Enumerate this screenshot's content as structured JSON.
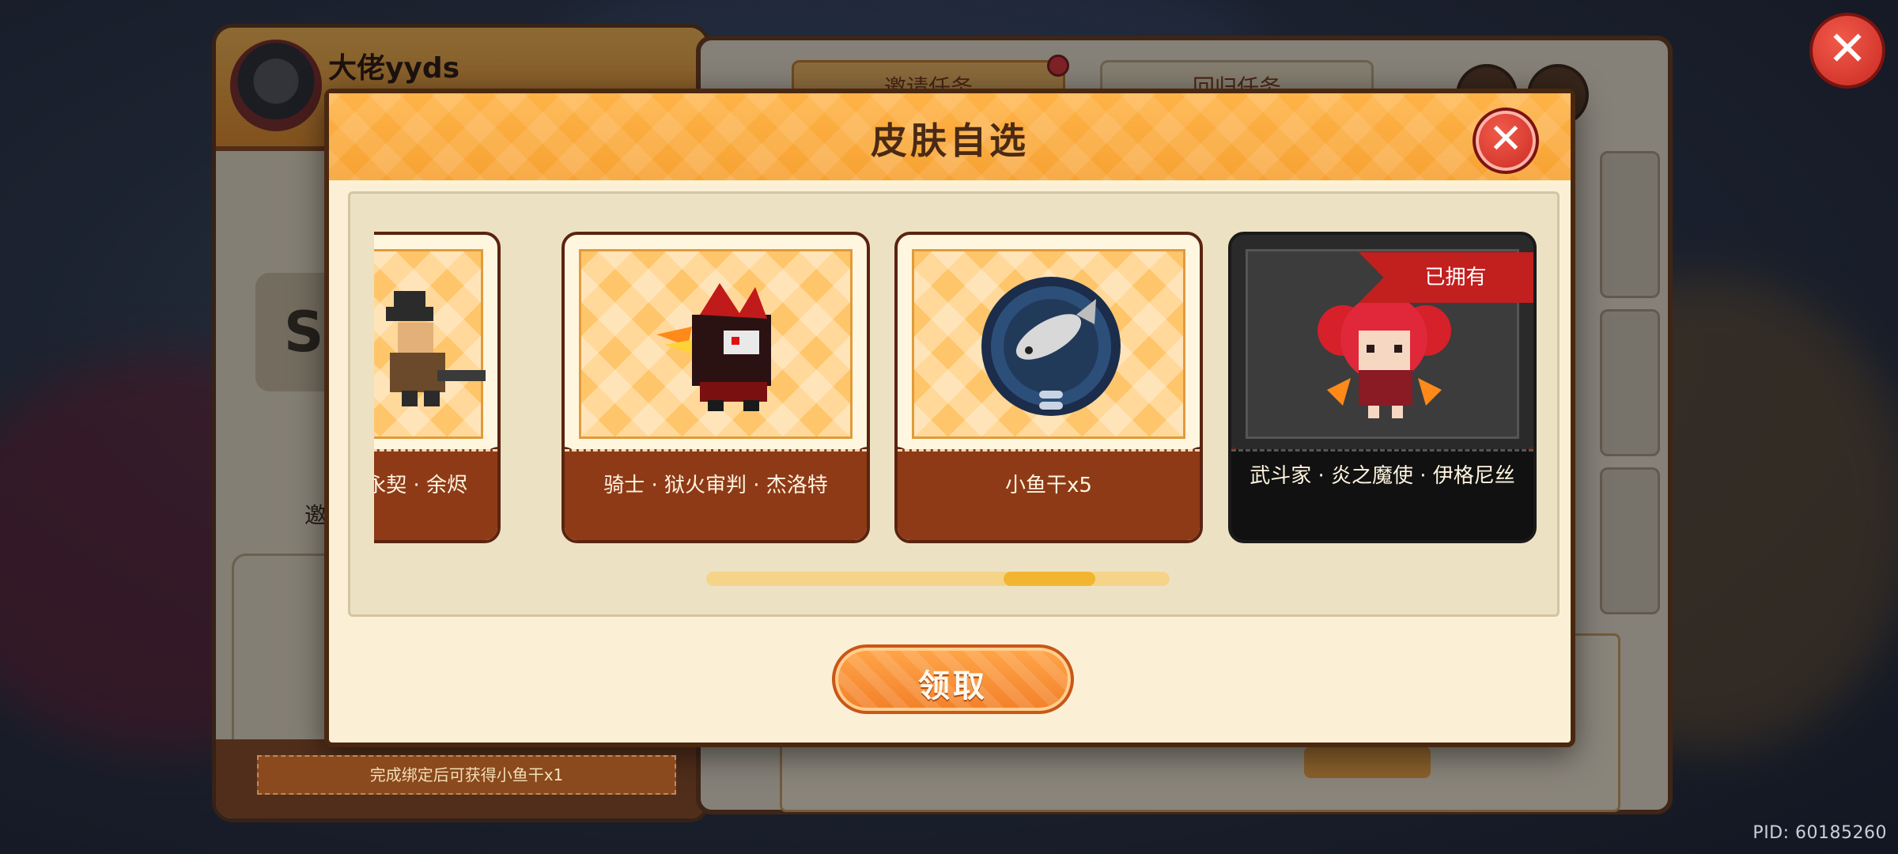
{
  "background": {
    "profile_name": "大佬yyds",
    "profile_card_text": "SK",
    "profile_label": "邀",
    "footer_text": "完成绑定后可获得小鱼干x1",
    "tab1": "邀请任务",
    "tab2": "回归任务",
    "pid": "PID: 60185260"
  },
  "dialog": {
    "title": "皮肤自选",
    "claim_label": "领取"
  },
  "cards": [
    {
      "label": "械永契 · 余烬",
      "owned": false
    },
    {
      "label": "骑士 · 狱火审判 · 杰洛特",
      "owned": false
    },
    {
      "label": "小鱼干x5",
      "owned": false
    },
    {
      "label": "武斗家 · 炎之魔使 · 伊格尼丝",
      "owned": true,
      "badge": "已拥有"
    }
  ],
  "colors": {
    "accent": "#f7a233",
    "close_red": "#d9342a",
    "card_bottom": "#8e3a17",
    "owned_ribbon": "#c21f1f"
  },
  "icons": [
    "close-icon",
    "fish-icon",
    "lock-icon",
    "key-icon"
  ],
  "scroll_position": 0.8
}
